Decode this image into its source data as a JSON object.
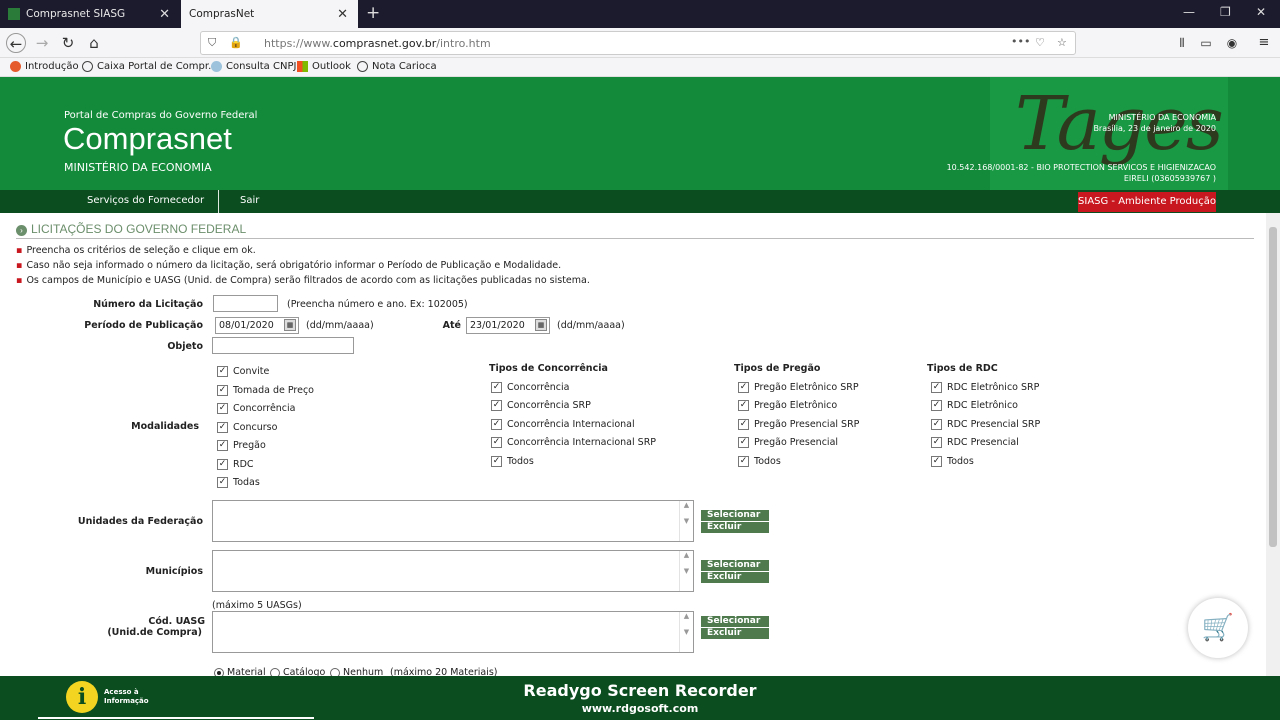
{
  "browser": {
    "tabs": [
      {
        "label": "Comprasnet SIASG"
      },
      {
        "label": "ComprasNet"
      }
    ],
    "url_prefix": "https://www.",
    "url_domain": "comprasnet.gov.br",
    "url_path": "/intro.htm",
    "bookmarks": [
      "Introdução",
      "Caixa Portal de Compr...",
      "Consulta CNPJ",
      "Outlook",
      "Nota Carioca"
    ]
  },
  "header": {
    "portal_label": "Portal de Compras do Governo Federal",
    "title": "Comprasnet",
    "ministry": "MINISTÉRIO DA ECONOMIA",
    "logo_text": "Tages",
    "right_ministry": "MINISTÉRIO DA ECONOMIA",
    "right_date": "Brasília, 23 de janeiro de 2020",
    "right_company": "10.542.168/0001-82 - BIO PROTECTION SERVICOS E HIGIENIZACAO",
    "right_company2": "EIRELI (03605939767 )"
  },
  "menu": {
    "fornecedor": "Serviços do Fornecedor",
    "sair": "Sair",
    "siasg": "SIASG - Ambiente Produção"
  },
  "page": {
    "section_title": "LICITAÇÕES DO GOVERNO FEDERAL",
    "bullets": [
      "Preencha os critérios de seleção e clique em ok.",
      "Caso não seja informado o número da licitação, será obrigatório informar o Período de Publicação e Modalidade.",
      "Os campos de Município e UASG (Unid. de Compra) serão filtrados de acordo com as licitações publicadas no sistema."
    ],
    "numero_label": "Número da Licitação",
    "numero_value": "",
    "numero_hint": "(Preencha número e ano. Ex: 102005)",
    "periodo_label": "Período de Publicação",
    "periodo_de": "08/01/2020",
    "date_hint": "(dd/mm/aaaa)",
    "ate_label": "Até",
    "periodo_ate": "23/01/2020",
    "objeto_label": "Objeto",
    "objeto_value": "",
    "modalidades_label": "Modalidades",
    "modalidades": [
      "Convite",
      "Tomada de Preço",
      "Concorrência",
      "Concurso",
      "Pregão",
      "RDC",
      "Todas"
    ],
    "concorrencia_title": "Tipos de Concorrência",
    "concorrencia": [
      "Concorrência",
      "Concorrência SRP",
      "Concorrência Internacional",
      "Concorrência Internacional SRP",
      "Todos"
    ],
    "pregao_title": "Tipos de Pregão",
    "pregao": [
      "Pregão Eletrônico SRP",
      "Pregão Eletrônico",
      "Pregão Presencial SRP",
      "Pregão Presencial",
      "Todos"
    ],
    "rdc_title": "Tipos de RDC",
    "rdc": [
      "RDC Eletrônico SRP",
      "RDC Eletrônico",
      "RDC Presencial SRP",
      "RDC Presencial",
      "Todos"
    ],
    "uf_label": "Unidades da Federação",
    "municipios_label": "Municípios",
    "uasg_hint": "(máximo 5 UASGs)",
    "uasg_label1": "Cód. UASG",
    "uasg_label2": "(Unid.de Compra)",
    "btn_selecionar": "Selecionar",
    "btn_excluir": "Excluir",
    "radio_material": "Material",
    "radio_catalogo": "Catálogo",
    "radio_nenhum": "Nenhum",
    "radio_hint": "(máximo 20 Materiais)"
  },
  "footer": {
    "info_line1": "Acesso à",
    "info_line2": "Informação",
    "recorder": "Readygo Screen Recorder",
    "recorder_url": "www.rdgosoft.com"
  },
  "colors": {
    "header_green": "#138a3a",
    "menu_green": "#0b4d1f",
    "siasg_red": "#c8171e",
    "button_green": "#4e7a4e"
  }
}
